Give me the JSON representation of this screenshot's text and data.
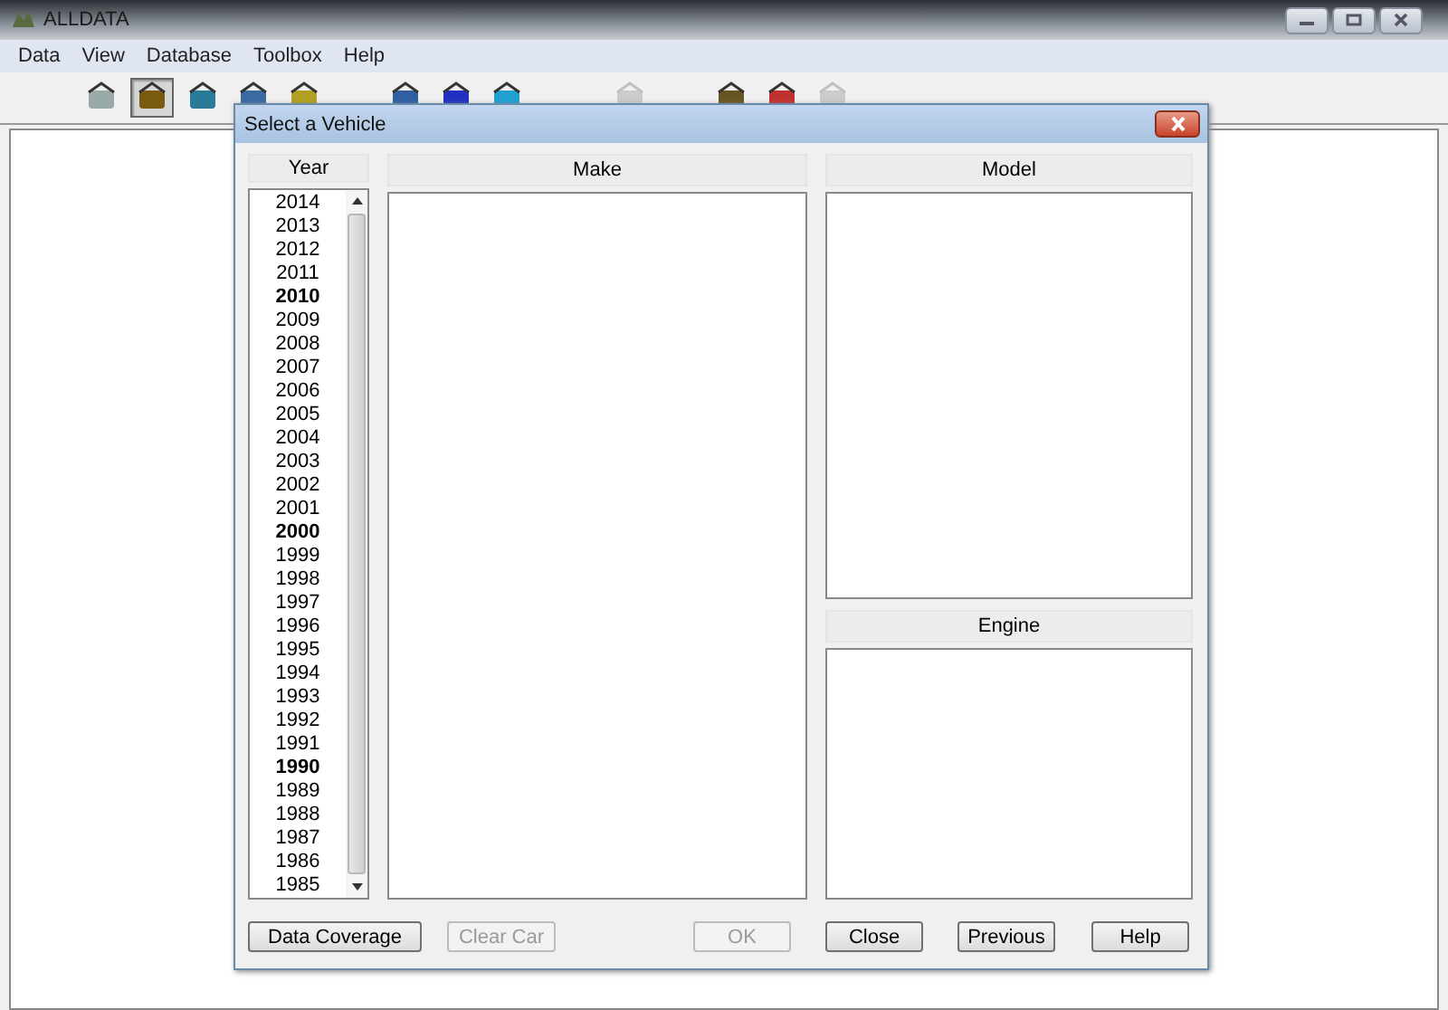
{
  "window": {
    "title": "ALLDATA"
  },
  "menu": [
    "Data",
    "View",
    "Database",
    "Toolbox",
    "Help"
  ],
  "toolbar": [
    {
      "pressed": false,
      "disabled": false
    },
    {
      "pressed": true,
      "disabled": false
    },
    {
      "pressed": false,
      "disabled": false
    },
    {
      "pressed": false,
      "disabled": false
    },
    {
      "pressed": false,
      "disabled": false
    },
    {
      "pressed": false,
      "disabled": false
    },
    {
      "pressed": false,
      "disabled": false
    },
    {
      "pressed": false,
      "disabled": false
    },
    {
      "pressed": false,
      "disabled": true
    },
    {
      "pressed": false,
      "disabled": false
    },
    {
      "pressed": false,
      "disabled": false
    },
    {
      "pressed": false,
      "disabled": true
    }
  ],
  "dialog": {
    "title": "Select a Vehicle",
    "year": {
      "heading": "Year",
      "items": [
        {
          "label": "2014",
          "bold": false
        },
        {
          "label": "2013",
          "bold": false
        },
        {
          "label": "2012",
          "bold": false
        },
        {
          "label": "2011",
          "bold": false
        },
        {
          "label": "2010",
          "bold": true
        },
        {
          "label": "2009",
          "bold": false
        },
        {
          "label": "2008",
          "bold": false
        },
        {
          "label": "2007",
          "bold": false
        },
        {
          "label": "2006",
          "bold": false
        },
        {
          "label": "2005",
          "bold": false
        },
        {
          "label": "2004",
          "bold": false
        },
        {
          "label": "2003",
          "bold": false
        },
        {
          "label": "2002",
          "bold": false
        },
        {
          "label": "2001",
          "bold": false
        },
        {
          "label": "2000",
          "bold": true
        },
        {
          "label": "1999",
          "bold": false
        },
        {
          "label": "1998",
          "bold": false
        },
        {
          "label": "1997",
          "bold": false
        },
        {
          "label": "1996",
          "bold": false
        },
        {
          "label": "1995",
          "bold": false
        },
        {
          "label": "1994",
          "bold": false
        },
        {
          "label": "1993",
          "bold": false
        },
        {
          "label": "1992",
          "bold": false
        },
        {
          "label": "1991",
          "bold": false
        },
        {
          "label": "1990",
          "bold": true
        },
        {
          "label": "1989",
          "bold": false
        },
        {
          "label": "1988",
          "bold": false
        },
        {
          "label": "1987",
          "bold": false
        },
        {
          "label": "1986",
          "bold": false
        },
        {
          "label": "1985",
          "bold": false
        }
      ]
    },
    "make": {
      "heading": "Make"
    },
    "model": {
      "heading": "Model"
    },
    "engine": {
      "heading": "Engine"
    },
    "buttons": [
      {
        "label": "Data Coverage",
        "disabled": false
      },
      {
        "label": "Clear Car",
        "disabled": true
      },
      {
        "label": "OK",
        "disabled": true
      },
      {
        "label": "Close",
        "disabled": false
      },
      {
        "label": "Previous",
        "disabled": false
      },
      {
        "label": "Help",
        "disabled": false
      }
    ]
  }
}
